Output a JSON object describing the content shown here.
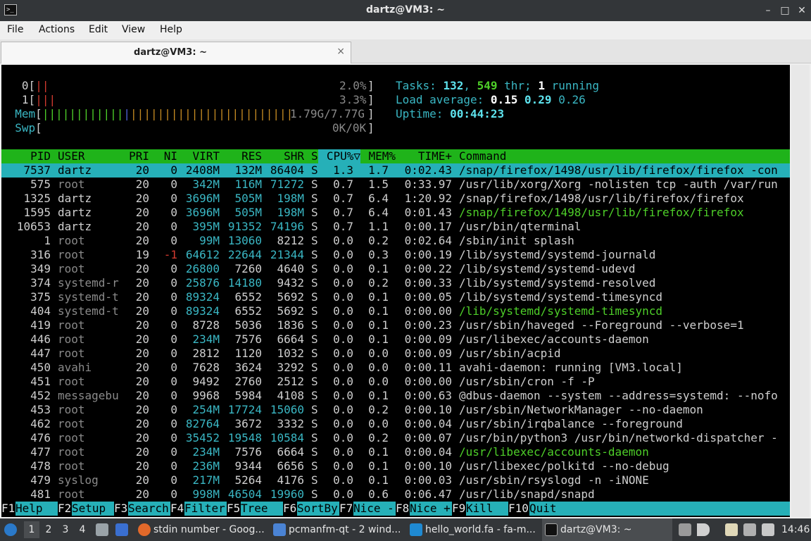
{
  "window": {
    "title": "dartz@VM3: ~",
    "icon": "terminal-icon",
    "controls": {
      "minimize": "–",
      "maximize": "□",
      "close": "✕"
    }
  },
  "menu": [
    "File",
    "Actions",
    "Edit",
    "View",
    "Help"
  ],
  "tab": {
    "label": "dartz@VM3: ~",
    "close": "×"
  },
  "meters": {
    "cpu0": {
      "label": "0",
      "bar": "||",
      "value": "2.0%"
    },
    "cpu1": {
      "label": "1",
      "bar": "|||",
      "value": "3.3%"
    },
    "mem": {
      "label": "Mem",
      "bar_a": "||||||||||||",
      "bar_b": "|",
      "bar_c": "||||||||||||||||||||||||",
      "value": "1.79G/7.77G"
    },
    "swp": {
      "label": "Swp",
      "value": "0K/0K"
    }
  },
  "stats": {
    "tasks_label": "Tasks: ",
    "tasks": "132",
    "threads": "549",
    "thr_label": " thr; ",
    "running": "1",
    "running_label": " running",
    "load_label": "Load average: ",
    "load1": "0.15",
    "load5": "0.29",
    "load15": "0.26",
    "uptime_label": "Uptime: ",
    "uptime": "00:44:23"
  },
  "columns": [
    "PID",
    "USER",
    "PRI",
    "NI",
    "VIRT",
    "RES",
    "SHR",
    "S",
    "CPU%▽",
    "MEM%",
    "TIME+",
    "Command"
  ],
  "processes": [
    {
      "pid": "7537",
      "user": "dartz",
      "pri": "20",
      "ni": "0",
      "virt": "2408M",
      "res": "132M",
      "shr": "86404",
      "s": "S",
      "cpu": "1.3",
      "mem": "1.7",
      "time": "0:02.43",
      "cmd": "/snap/firefox/1498/usr/lib/firefox/firefox -con"
    },
    {
      "pid": "575",
      "user": "root",
      "pri": "20",
      "ni": "0",
      "virt": "342M",
      "res": "116M",
      "shr": "71272",
      "s": "S",
      "cpu": "0.7",
      "mem": "1.5",
      "time": "0:33.97",
      "cmd": "/usr/lib/xorg/Xorg -nolisten tcp -auth /var/run"
    },
    {
      "pid": "1325",
      "user": "dartz",
      "pri": "20",
      "ni": "0",
      "virt": "3696M",
      "res": "505M",
      "shr": "198M",
      "s": "S",
      "cpu": "0.7",
      "mem": "6.4",
      "time": "1:20.92",
      "cmd": "/snap/firefox/1498/usr/lib/firefox/firefox"
    },
    {
      "pid": "1595",
      "user": "dartz",
      "pri": "20",
      "ni": "0",
      "virt": "3696M",
      "res": "505M",
      "shr": "198M",
      "s": "S",
      "cpu": "0.7",
      "mem": "6.4",
      "time": "0:01.43",
      "cmd": "/snap/firefox/1498/usr/lib/firefox/firefox"
    },
    {
      "pid": "10653",
      "user": "dartz",
      "pri": "20",
      "ni": "0",
      "virt": "395M",
      "res": "91352",
      "shr": "74196",
      "s": "S",
      "cpu": "0.7",
      "mem": "1.1",
      "time": "0:00.17",
      "cmd": "/usr/bin/qterminal"
    },
    {
      "pid": "1",
      "user": "root",
      "pri": "20",
      "ni": "0",
      "virt": "99M",
      "res": "13060",
      "shr": "8212",
      "s": "S",
      "cpu": "0.0",
      "mem": "0.2",
      "time": "0:02.64",
      "cmd": "/sbin/init splash"
    },
    {
      "pid": "316",
      "user": "root",
      "pri": "19",
      "ni": "-1",
      "virt": "64612",
      "res": "22644",
      "shr": "21344",
      "s": "S",
      "cpu": "0.0",
      "mem": "0.3",
      "time": "0:00.19",
      "cmd": "/lib/systemd/systemd-journald"
    },
    {
      "pid": "349",
      "user": "root",
      "pri": "20",
      "ni": "0",
      "virt": "26800",
      "res": "7260",
      "shr": "4640",
      "s": "S",
      "cpu": "0.0",
      "mem": "0.1",
      "time": "0:00.22",
      "cmd": "/lib/systemd/systemd-udevd"
    },
    {
      "pid": "374",
      "user": "systemd-r",
      "pri": "20",
      "ni": "0",
      "virt": "25876",
      "res": "14180",
      "shr": "9432",
      "s": "S",
      "cpu": "0.0",
      "mem": "0.2",
      "time": "0:00.33",
      "cmd": "/lib/systemd/systemd-resolved"
    },
    {
      "pid": "375",
      "user": "systemd-t",
      "pri": "20",
      "ni": "0",
      "virt": "89324",
      "res": "6552",
      "shr": "5692",
      "s": "S",
      "cpu": "0.0",
      "mem": "0.1",
      "time": "0:00.05",
      "cmd": "/lib/systemd/systemd-timesyncd"
    },
    {
      "pid": "404",
      "user": "systemd-t",
      "pri": "20",
      "ni": "0",
      "virt": "89324",
      "res": "6552",
      "shr": "5692",
      "s": "S",
      "cpu": "0.0",
      "mem": "0.1",
      "time": "0:00.00",
      "cmd": "/lib/systemd/systemd-timesyncd"
    },
    {
      "pid": "419",
      "user": "root",
      "pri": "20",
      "ni": "0",
      "virt": "8728",
      "res": "5036",
      "shr": "1836",
      "s": "S",
      "cpu": "0.0",
      "mem": "0.1",
      "time": "0:00.23",
      "cmd": "/usr/sbin/haveged --Foreground --verbose=1"
    },
    {
      "pid": "446",
      "user": "root",
      "pri": "20",
      "ni": "0",
      "virt": "234M",
      "res": "7576",
      "shr": "6664",
      "s": "S",
      "cpu": "0.0",
      "mem": "0.1",
      "time": "0:00.09",
      "cmd": "/usr/libexec/accounts-daemon"
    },
    {
      "pid": "447",
      "user": "root",
      "pri": "20",
      "ni": "0",
      "virt": "2812",
      "res": "1120",
      "shr": "1032",
      "s": "S",
      "cpu": "0.0",
      "mem": "0.0",
      "time": "0:00.09",
      "cmd": "/usr/sbin/acpid"
    },
    {
      "pid": "450",
      "user": "avahi",
      "pri": "20",
      "ni": "0",
      "virt": "7628",
      "res": "3624",
      "shr": "3292",
      "s": "S",
      "cpu": "0.0",
      "mem": "0.0",
      "time": "0:00.11",
      "cmd": "avahi-daemon: running [VM3.local]"
    },
    {
      "pid": "451",
      "user": "root",
      "pri": "20",
      "ni": "0",
      "virt": "9492",
      "res": "2760",
      "shr": "2512",
      "s": "S",
      "cpu": "0.0",
      "mem": "0.0",
      "time": "0:00.00",
      "cmd": "/usr/sbin/cron -f -P"
    },
    {
      "pid": "452",
      "user": "messagebu",
      "pri": "20",
      "ni": "0",
      "virt": "9968",
      "res": "5984",
      "shr": "4108",
      "s": "S",
      "cpu": "0.0",
      "mem": "0.1",
      "time": "0:00.63",
      "cmd": "@dbus-daemon --system --address=systemd: --nofo"
    },
    {
      "pid": "453",
      "user": "root",
      "pri": "20",
      "ni": "0",
      "virt": "254M",
      "res": "17724",
      "shr": "15060",
      "s": "S",
      "cpu": "0.0",
      "mem": "0.2",
      "time": "0:00.10",
      "cmd": "/usr/sbin/NetworkManager --no-daemon"
    },
    {
      "pid": "462",
      "user": "root",
      "pri": "20",
      "ni": "0",
      "virt": "82764",
      "res": "3672",
      "shr": "3332",
      "s": "S",
      "cpu": "0.0",
      "mem": "0.0",
      "time": "0:00.04",
      "cmd": "/usr/sbin/irqbalance --foreground"
    },
    {
      "pid": "476",
      "user": "root",
      "pri": "20",
      "ni": "0",
      "virt": "35452",
      "res": "19548",
      "shr": "10584",
      "s": "S",
      "cpu": "0.0",
      "mem": "0.2",
      "time": "0:00.07",
      "cmd": "/usr/bin/python3 /usr/bin/networkd-dispatcher -"
    },
    {
      "pid": "477",
      "user": "root",
      "pri": "20",
      "ni": "0",
      "virt": "234M",
      "res": "7576",
      "shr": "6664",
      "s": "S",
      "cpu": "0.0",
      "mem": "0.1",
      "time": "0:00.04",
      "cmd": "/usr/libexec/accounts-daemon"
    },
    {
      "pid": "478",
      "user": "root",
      "pri": "20",
      "ni": "0",
      "virt": "236M",
      "res": "9344",
      "shr": "6656",
      "s": "S",
      "cpu": "0.0",
      "mem": "0.1",
      "time": "0:00.10",
      "cmd": "/usr/libexec/polkitd --no-debug"
    },
    {
      "pid": "479",
      "user": "syslog",
      "pri": "20",
      "ni": "0",
      "virt": "217M",
      "res": "5264",
      "shr": "4176",
      "s": "S",
      "cpu": "0.0",
      "mem": "0.1",
      "time": "0:00.03",
      "cmd": "/usr/sbin/rsyslogd -n -iNONE"
    },
    {
      "pid": "481",
      "user": "root",
      "pri": "20",
      "ni": "0",
      "virt": "998M",
      "res": "46504",
      "shr": "19960",
      "s": "S",
      "cpu": "0.0",
      "mem": "0.6",
      "time": "0:06.47",
      "cmd": "/usr/lib/snapd/snapd"
    }
  ],
  "thread_rows": [
    3,
    10,
    20
  ],
  "fkeys": [
    {
      "key": "F1",
      "label": "Help  "
    },
    {
      "key": "F2",
      "label": "Setup "
    },
    {
      "key": "F3",
      "label": "Search"
    },
    {
      "key": "F4",
      "label": "Filter"
    },
    {
      "key": "F5",
      "label": "Tree  "
    },
    {
      "key": "F6",
      "label": "SortBy"
    },
    {
      "key": "F7",
      "label": "Nice -"
    },
    {
      "key": "F8",
      "label": "Nice +"
    },
    {
      "key": "F9",
      "label": "Kill  "
    },
    {
      "key": "F10",
      "label": "Quit  "
    }
  ],
  "taskbar": {
    "workspaces": [
      "1",
      "2",
      "3",
      "4"
    ],
    "tasks": [
      {
        "icon": "firefox-icon",
        "label": "stdin number - Goog..."
      },
      {
        "icon": "folder-icon",
        "label": "pcmanfm-qt - 2 wind..."
      },
      {
        "icon": "vscode-icon",
        "label": "hello_world.fa - fa-m..."
      },
      {
        "icon": "terminal-icon",
        "label": "dartz@VM3: ~"
      }
    ],
    "clock": "14:46"
  },
  "colors": {
    "header_bg": "#1fb31a",
    "selected_bg": "#26b0b8",
    "accent_cyan": "#3ab7c4"
  }
}
